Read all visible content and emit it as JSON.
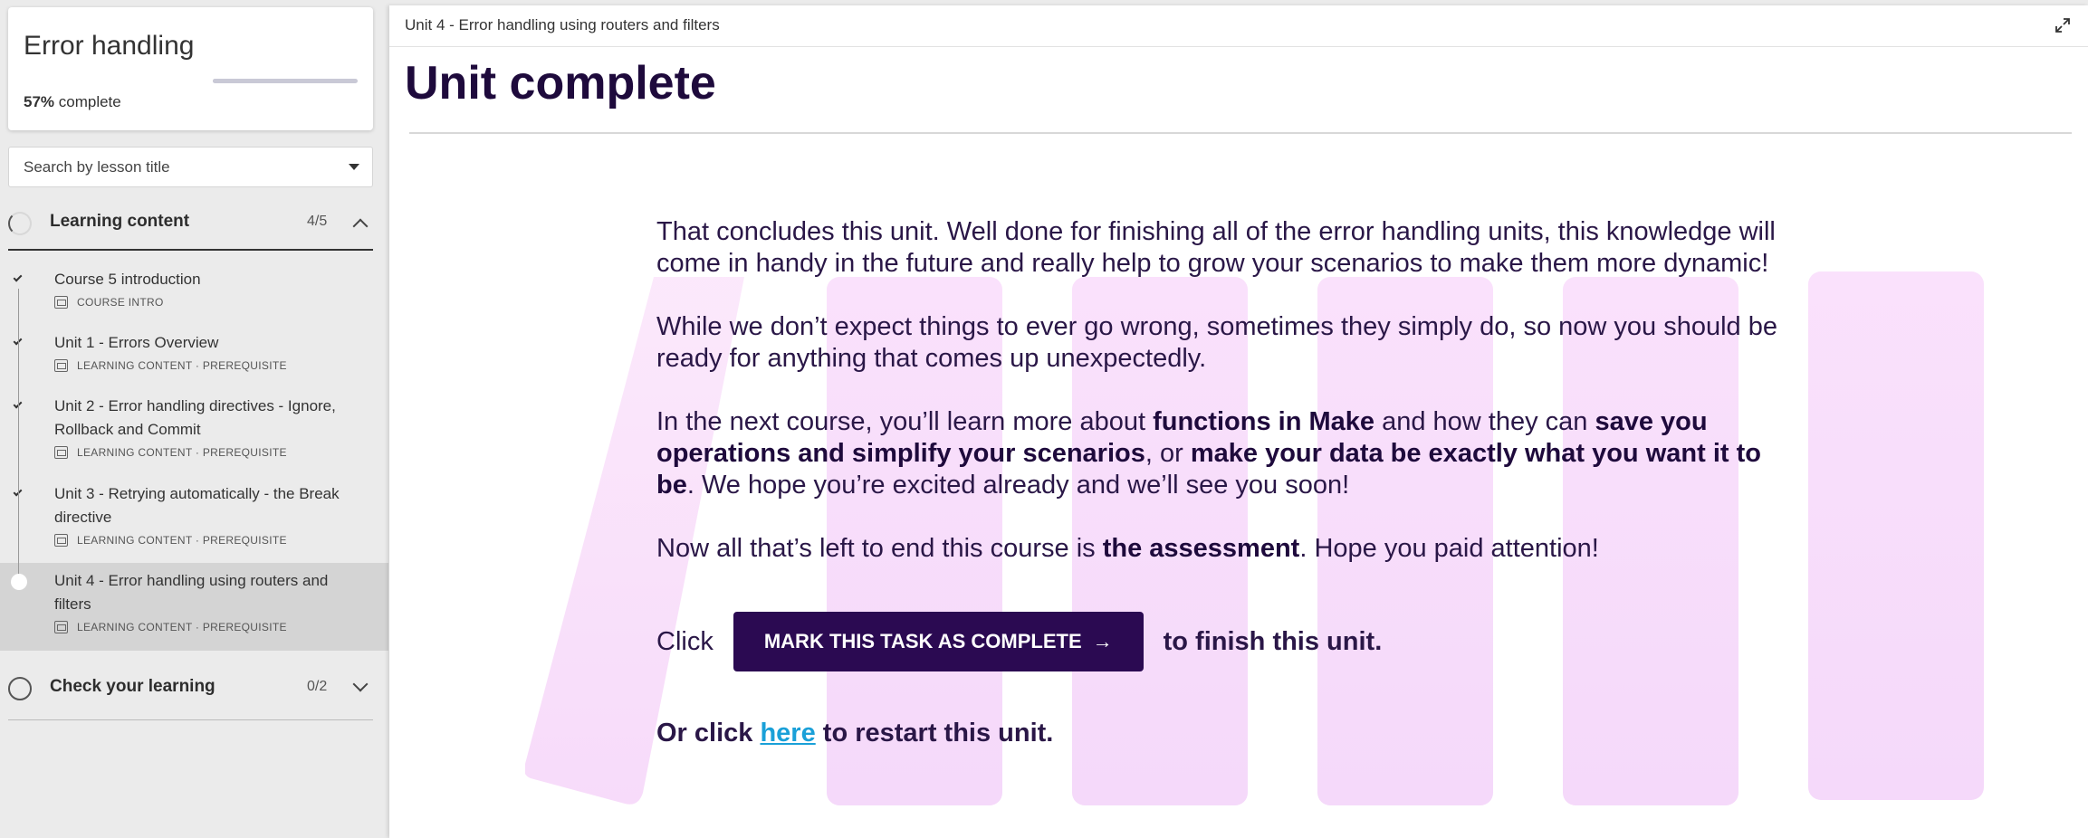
{
  "course": {
    "title": "Error handling",
    "progress_percent": "57%",
    "progress_suffix": " complete",
    "progress_value": 0.57
  },
  "search": {
    "placeholder": "Search by lesson title"
  },
  "sections": [
    {
      "label": "Learning content",
      "count": "4/5",
      "expanded": true
    },
    {
      "label": "Check your learning",
      "count": "0/2",
      "expanded": false
    }
  ],
  "lessons": [
    {
      "title": "Course 5 introduction",
      "meta": "COURSE INTRO",
      "done": true
    },
    {
      "title": "Unit 1 - Errors Overview",
      "meta": "LEARNING CONTENT · PREREQUISITE",
      "done": true
    },
    {
      "title": "Unit 2 - Error handling directives - Ignore, Rollback and Commit",
      "meta": "LEARNING CONTENT · PREREQUISITE",
      "done": true
    },
    {
      "title": "Unit 3 - Retrying automatically - the Break directive",
      "meta": "LEARNING CONTENT · PREREQUISITE",
      "done": true
    },
    {
      "title": "Unit 4 - Error handling using routers and filters",
      "meta": "LEARNING CONTENT · PREREQUISITE",
      "done": false,
      "active": true
    }
  ],
  "main": {
    "breadcrumb": "Unit 4 - Error handling using routers and filters",
    "title": "Unit complete",
    "p1": "That concludes this unit. Well done for finishing all of the error handling units, this knowledge will come in handy in the future and really help to grow your scenarios to make them more dynamic!",
    "p2": "While we don’t expect things to ever go wrong, sometimes they simply do, so now you should be ready for anything that comes up unexpectedly.",
    "p3": {
      "a": "In the next course, you’ll learn more about ",
      "b1": "functions in Make",
      "c": " and how they can ",
      "b2": "save you operations and simplify your scenarios",
      "d": ", or ",
      "b3": "make your data be exactly what you want it to be",
      "e": ". We hope you’re excited already and we’ll see you soon!"
    },
    "p4": {
      "a": "Now all that’s left to end this course is ",
      "b": "the assessment",
      "c": ". Hope you paid attention!"
    },
    "click_prefix": "Click",
    "mark_button": "MARK THIS TASK AS COMPLETE",
    "mark_arrow": "→",
    "click_suffix": "to finish this unit.",
    "restart_prefix": "Or click ",
    "restart_link": "here",
    "restart_suffix": " to restart this unit."
  },
  "colors": {
    "brand_dark": "#2b0a52",
    "link": "#1aa0d8",
    "deco_pink": "#f3d2f9"
  },
  "icons": [
    "chevron-up-icon",
    "chevron-down-icon",
    "check-icon",
    "expand-icon",
    "lesson-icon",
    "arrow-right-icon"
  ]
}
